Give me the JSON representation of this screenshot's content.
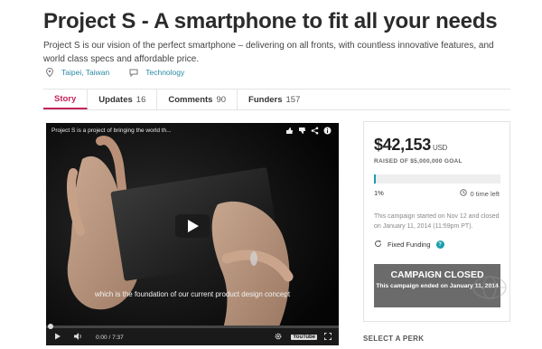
{
  "project": {
    "title": "Project S - A smartphone to fit all your needs",
    "description": "Project S is our vision of the perfect smartphone – delivering on all fronts, with countless innovative features, and world class specs and affordable price.",
    "location": "Taipei, Taiwan",
    "category": "Technology",
    "location_icon": "map-pin-icon",
    "category_icon": "chat-bubble-icon"
  },
  "tabs": [
    {
      "label": "Story",
      "count": ""
    },
    {
      "label": "Updates",
      "count": "16"
    },
    {
      "label": "Comments",
      "count": "90"
    },
    {
      "label": "Funders",
      "count": "157"
    }
  ],
  "video": {
    "title": "Project S is a project of bringing the world th...",
    "caption": "which is the foundation of our current product design concept",
    "time": "0:00 / 7:37",
    "provider": "YouTube",
    "progress_fraction": 0.0
  },
  "campaign": {
    "amount": "$42,153",
    "currency": "USD",
    "raised_of": "RAISED OF $5,000,000 GOAL",
    "percent_label": "1%",
    "percent_value": 0.01,
    "time_left": "0 time left",
    "started": "This campaign started on Nov 12 and closed on January 11, 2014 (11:59pm PT).",
    "funding_type": "Fixed Funding",
    "closed_title": "CAMPAIGN CLOSED",
    "closed_subtitle": "This campaign ended on January 11, 2014",
    "accent": "#1a9dab"
  },
  "perk_heading": "SELECT A PERK"
}
